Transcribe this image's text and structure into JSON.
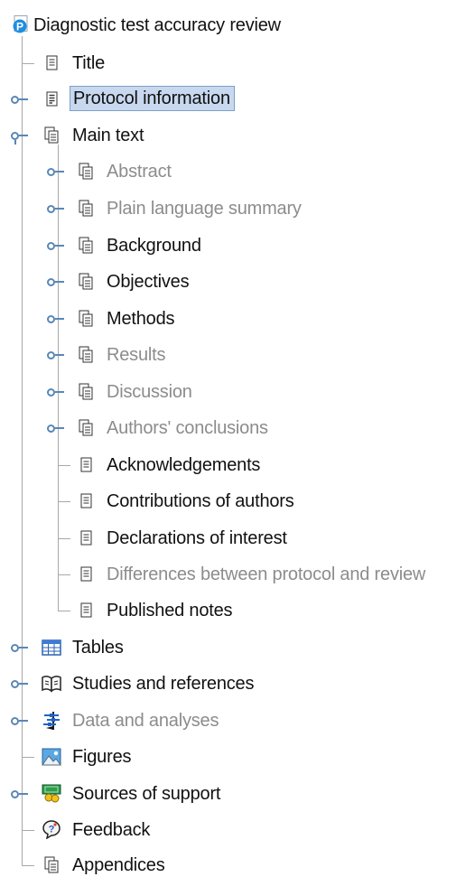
{
  "tree": {
    "root": {
      "label": "Diagnostic test accuracy review",
      "icon": "review-p-icon"
    },
    "items": [
      {
        "label": "Title",
        "icon": "document-icon",
        "expandable": false,
        "disabled": false
      },
      {
        "label": "Protocol information",
        "icon": "document-lines-icon",
        "expandable": true,
        "expanded": false,
        "selected": true,
        "disabled": false
      },
      {
        "label": "Main text",
        "icon": "documents-icon",
        "expandable": true,
        "expanded": true,
        "disabled": false
      },
      {
        "label": "Abstract",
        "icon": "documents-icon",
        "expandable": true,
        "disabled": true
      },
      {
        "label": "Plain language summary",
        "icon": "documents-icon",
        "expandable": true,
        "disabled": true
      },
      {
        "label": "Background",
        "icon": "documents-icon",
        "expandable": true,
        "disabled": false
      },
      {
        "label": "Objectives",
        "icon": "documents-icon",
        "expandable": true,
        "disabled": false
      },
      {
        "label": "Methods",
        "icon": "documents-icon",
        "expandable": true,
        "disabled": false
      },
      {
        "label": "Results",
        "icon": "documents-icon",
        "expandable": true,
        "disabled": true
      },
      {
        "label": "Discussion",
        "icon": "documents-icon",
        "expandable": true,
        "disabled": true
      },
      {
        "label": "Authors' conclusions",
        "icon": "documents-icon",
        "expandable": true,
        "disabled": true
      },
      {
        "label": "Acknowledgements",
        "icon": "document-icon",
        "expandable": false,
        "disabled": false
      },
      {
        "label": "Contributions of authors",
        "icon": "document-icon",
        "expandable": false,
        "disabled": false
      },
      {
        "label": "Declarations of interest",
        "icon": "document-icon",
        "expandable": false,
        "disabled": false
      },
      {
        "label": "Differences between protocol and review",
        "icon": "document-icon",
        "expandable": false,
        "disabled": true
      },
      {
        "label": "Published notes",
        "icon": "document-icon",
        "expandable": false,
        "disabled": false
      },
      {
        "label": "Tables",
        "icon": "table-icon",
        "expandable": true,
        "disabled": false
      },
      {
        "label": "Studies and references",
        "icon": "book-icon",
        "expandable": true,
        "disabled": false
      },
      {
        "label": "Data and analyses",
        "icon": "forest-plot-icon",
        "expandable": true,
        "disabled": true
      },
      {
        "label": "Figures",
        "icon": "image-icon",
        "expandable": false,
        "disabled": false
      },
      {
        "label": "Sources of support",
        "icon": "money-icon",
        "expandable": true,
        "disabled": false
      },
      {
        "label": "Feedback",
        "icon": "feedback-bubble-icon",
        "expandable": false,
        "disabled": false
      },
      {
        "label": "Appendices",
        "icon": "documents-icon",
        "expandable": false,
        "disabled": false
      }
    ]
  },
  "colors": {
    "selection_bg": "#c8d8ef",
    "selection_border": "#7f9fc9",
    "toggle": "#5a87b6",
    "disabled_text": "#8c8c8c",
    "tree_lines": "#a8a8a8"
  }
}
